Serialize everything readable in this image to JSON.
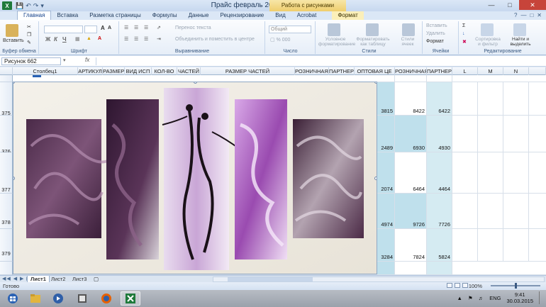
{
  "window": {
    "title": "Прайс февраль 2015 - Microsoft Excel",
    "context_tab_header": "Работа с рисунками",
    "app_icon": "X",
    "qat": [
      "save-icon",
      "undo-icon",
      "redo-icon",
      "dropdown-icon"
    ]
  },
  "tabs": {
    "file": "Главная",
    "items": [
      "Вставка",
      "Разметка страницы",
      "Формулы",
      "Данные",
      "Рецензирование",
      "Вид",
      "Acrobat"
    ],
    "format": "Формат"
  },
  "ribbon": {
    "clipboard": {
      "paste": "Вставить",
      "name": "Буфер обмена"
    },
    "font": {
      "bold": "Ж",
      "italic": "К",
      "underline": "Ч",
      "grow": "A",
      "shrink": "A",
      "name": "Шрифт"
    },
    "alignment": {
      "wrap": "Перенос текста",
      "merge": "Объединить и поместить в центре",
      "name": "Выравнивание"
    },
    "number": {
      "format": "Общий",
      "name": "Число"
    },
    "styles": {
      "conditional": "Условное форматирование",
      "as_table": "Форматировать как таблицу",
      "cell_styles": "Стили ячеек",
      "name": "Стили"
    },
    "cells": {
      "insert": "Вставить",
      "delete": "Удалить",
      "format": "Формат",
      "name": "Ячейки"
    },
    "editing": {
      "sort": "Сортировка и фильтр",
      "find": "Найти и выделить",
      "name": "Редактирование"
    }
  },
  "formula_bar": {
    "name_box": "Рисунок 662",
    "fx": "fx",
    "formula": ""
  },
  "columns": [
    "Столбец1",
    "АРТИКУЛ",
    "РАЗМЕР",
    "ВИД ИСП",
    "КОЛ-ВО",
    "ЧАСТЕЙ",
    "РАЗМЕР ЧАСТЕЙ",
    "РОЗНИЧНАЯ Ц",
    "ПАРТНЕРС",
    "ОПТОВАЯ ЦЕ",
    "РОЗНИЧНАЯ",
    "ПАРТНЕРС",
    "L",
    "M",
    "N"
  ],
  "rows": [
    {
      "num": "375",
      "vals": [
        "3815",
        "8422",
        "6422"
      ]
    },
    {
      "num": "376",
      "vals": [
        "2489",
        "6930",
        "4930"
      ]
    },
    {
      "num": "377",
      "vals": [
        "2074",
        "6464",
        "4464"
      ]
    },
    {
      "num": "378",
      "vals": [
        "4974",
        "9726",
        "7726"
      ]
    },
    {
      "num": "379",
      "vals": [
        "3284",
        "7824",
        "5824"
      ]
    }
  ],
  "sheets": [
    "Лист1",
    "Лист2",
    "Лист3"
  ],
  "status": {
    "ready": "Готово",
    "zoom": "100%"
  },
  "tray": {
    "lang": "ENG",
    "time": "9:41",
    "date": "30.03.2015"
  }
}
